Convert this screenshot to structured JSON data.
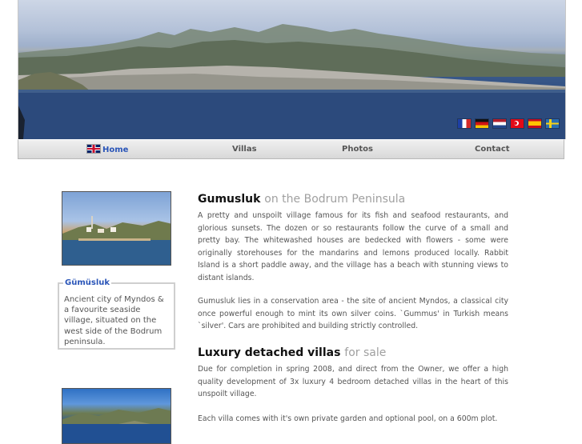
{
  "header": {
    "flags": [
      {
        "name": "france-flag-icon",
        "cls": "fr"
      },
      {
        "name": "germany-flag-icon",
        "cls": "de"
      },
      {
        "name": "netherlands-flag-icon",
        "cls": "nl"
      },
      {
        "name": "turkey-flag-icon",
        "cls": "tr"
      },
      {
        "name": "spain-flag-icon",
        "cls": "es"
      },
      {
        "name": "sweden-flag-icon",
        "cls": "se"
      }
    ]
  },
  "nav": {
    "home": "Home",
    "villas": "Villas",
    "photos": "Photos",
    "contact": "Contact"
  },
  "sidebar": {
    "box_title": "Gümüsluk",
    "box_text": "Ancient city of Myndos & a favourite seaside village, situated on the west side of the Bodrum peninsula."
  },
  "main": {
    "section1": {
      "title": "Gumusluk",
      "subtitle": "on the Bodrum Peninsula",
      "p1": "A pretty and unspoilt village famous for its fish and seafood restaurants, and glorious sunsets. The dozen or so restaurants follow the curve of a small and pretty bay. The whitewashed houses are bedecked with flowers - some were originally storehouses for the mandarins and lemons produced locally. Rabbit Island is a short paddle away, and the village has a beach with stunning views to distant islands.",
      "p2": "Gumusluk lies in a conservation area - the site of ancient Myndos, a classical city once powerful enough to mint its own silver coins. `Gummus' in Turkish means `silver'. Cars are prohibited and building strictly controlled."
    },
    "section2": {
      "title": "Luxury detached villas",
      "subtitle": "for sale",
      "p1": "Due for completion in spring 2008, and direct from the Owner, we offer a high quality development of 3x luxury 4 bedroom detached villas in the heart of this unspoilt village.",
      "p2": "Each villa comes with it's own private garden and optional pool, on a 600m plot."
    }
  },
  "colors": {
    "link_active": "#2a55b8",
    "heading_sub": "#a0a0a0"
  }
}
